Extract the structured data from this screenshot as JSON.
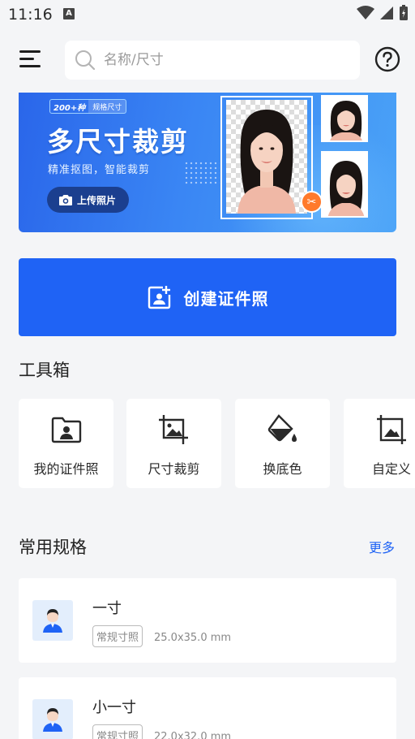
{
  "status_bar": {
    "time": "11:16",
    "notification_letter": "A"
  },
  "search": {
    "placeholder": "名称/尺寸"
  },
  "banner": {
    "badge_count": "200+种",
    "badge_label": "规格尺寸",
    "title": "多尺寸裁剪",
    "subtitle": "精准抠图，智能裁剪",
    "upload_label": "上传照片"
  },
  "create_button": {
    "label": "创建证件照"
  },
  "toolbox": {
    "title": "工具箱",
    "items": [
      {
        "label": "我的证件照",
        "icon": "folder-portrait-icon"
      },
      {
        "label": "尺寸裁剪",
        "icon": "crop-image-icon"
      },
      {
        "label": "换底色",
        "icon": "paint-bucket-icon"
      },
      {
        "label": "自定义",
        "icon": "custom-frame-icon"
      }
    ]
  },
  "specs": {
    "title": "常用规格",
    "more_label": "更多",
    "items": [
      {
        "name": "一寸",
        "tag": "常规寸照",
        "size": "25.0x35.0 mm"
      },
      {
        "name": "小一寸",
        "tag": "常规寸照",
        "size": "22.0x32.0 mm"
      }
    ]
  },
  "colors": {
    "primary": "#1f63f5",
    "background": "#f4f5f7",
    "accent_orange": "#ff7a2b"
  }
}
